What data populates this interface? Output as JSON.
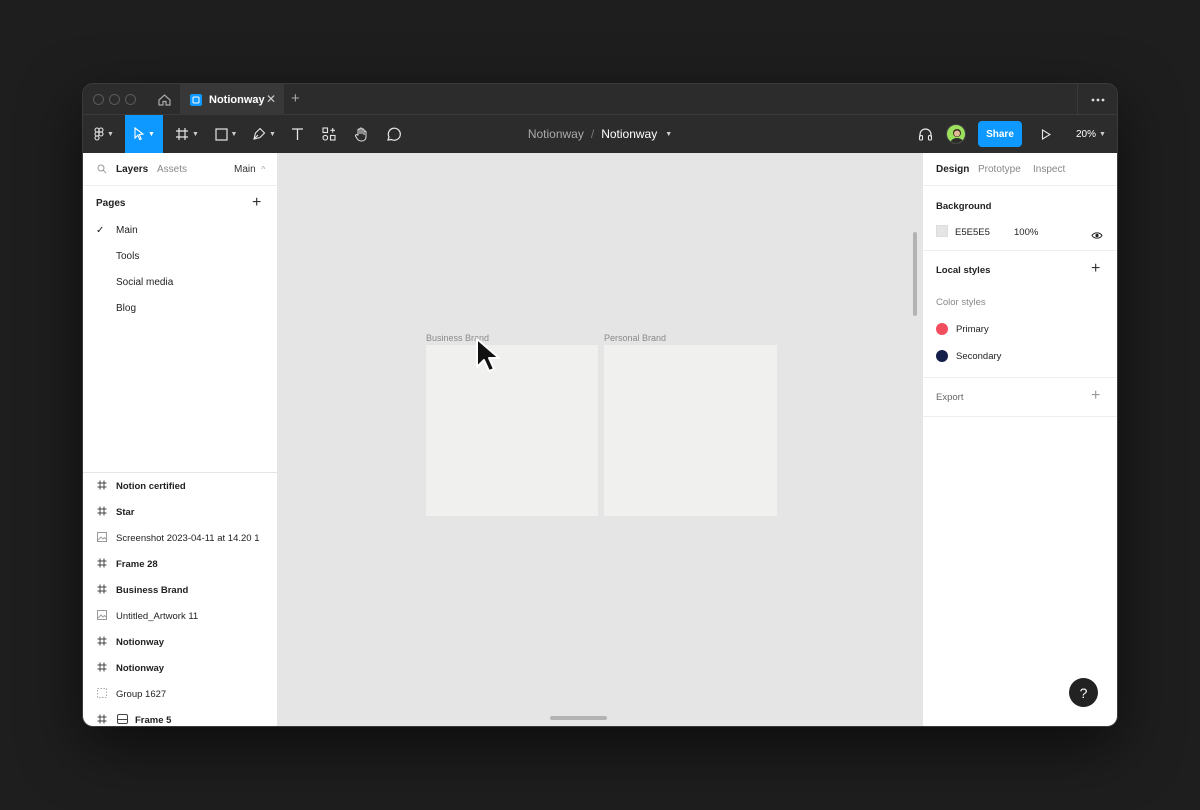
{
  "window": {
    "tab": {
      "title": "Notionway"
    }
  },
  "toolbar": {
    "file_project": "Notionway",
    "file_separator": "/",
    "file_name": "Notionway",
    "share_label": "Share",
    "zoom": "20%",
    "accent": "#0d99ff"
  },
  "left_panel": {
    "tabs": {
      "layers": "Layers",
      "assets": "Assets"
    },
    "page_selector": "Main",
    "pages_title": "Pages",
    "pages": [
      {
        "label": "Main",
        "selected": true
      },
      {
        "label": "Tools",
        "selected": false
      },
      {
        "label": "Social media",
        "selected": false
      },
      {
        "label": "Blog",
        "selected": false
      }
    ],
    "layers": [
      {
        "label": "Notion certified",
        "icon": "frame-icon"
      },
      {
        "label": "Star",
        "icon": "frame-icon"
      },
      {
        "label": "Screenshot 2023-04-11 at 14.20 1",
        "icon": "image-icon"
      },
      {
        "label": "Frame 28",
        "icon": "frame-icon"
      },
      {
        "label": "Business Brand",
        "icon": "frame-icon"
      },
      {
        "label": "Untitled_Artwork 11",
        "icon": "image-icon"
      },
      {
        "label": "Notionway",
        "icon": "frame-icon"
      },
      {
        "label": "Notionway",
        "icon": "frame-icon"
      },
      {
        "label": "Group 1627",
        "icon": "group-icon"
      },
      {
        "label": "Frame 5",
        "icon": "frame-icon"
      }
    ]
  },
  "canvas": {
    "background": "#e5e5e5",
    "frames": [
      {
        "label": "Business Brand"
      },
      {
        "label": "Personal Brand"
      }
    ]
  },
  "right_panel": {
    "tabs": {
      "design": "Design",
      "prototype": "Prototype",
      "inspect": "Inspect"
    },
    "background": {
      "title": "Background",
      "hex": "E5E5E5",
      "opacity": "100%"
    },
    "local_styles": {
      "title": "Local styles",
      "color_styles_title": "Color styles",
      "colors": [
        {
          "name": "Primary",
          "color": "#f24e5e"
        },
        {
          "name": "Secondary",
          "color": "#14204a"
        }
      ]
    },
    "export": {
      "title": "Export"
    },
    "help_label": "?"
  }
}
